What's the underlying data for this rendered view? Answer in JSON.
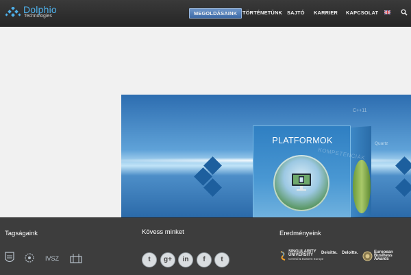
{
  "header": {
    "logo": {
      "name": "Dolphio",
      "subtitle": "Technologies"
    },
    "nav": [
      {
        "label": "MEGOLDÁSAINK",
        "active": true
      },
      {
        "label": "TÖRTÉNETÜNK",
        "active": false
      },
      {
        "label": "SAJTÓ",
        "active": false
      },
      {
        "label": "KARRIER",
        "active": false
      },
      {
        "label": "KAPCSOLAT",
        "active": false
      }
    ],
    "language_icon": "uk-flag-icon",
    "search_icon": "search-icon"
  },
  "banner": {
    "title": "PLATFORMOK",
    "side_labels": [
      "C++11",
      "Quartz",
      "KOMPETENCIÁK"
    ]
  },
  "footer": {
    "memberships": {
      "heading": "Tagságaink"
    },
    "follow": {
      "heading": "Kövess minket",
      "networks": [
        {
          "name": "tumblr",
          "glyph": "t"
        },
        {
          "name": "google-plus",
          "glyph": "g+"
        },
        {
          "name": "linkedin",
          "glyph": "in"
        },
        {
          "name": "facebook",
          "glyph": "f"
        },
        {
          "name": "twitter",
          "glyph": "t"
        }
      ]
    },
    "achievements": {
      "heading": "Eredményeink",
      "awards": [
        {
          "line1": "SINGULARITY",
          "line2": "UNIVERSITY",
          "line3": "Central & Eastern Europe"
        },
        {
          "line1": "Deloitte."
        },
        {
          "line1": "Deloitte."
        },
        {
          "line1": "European",
          "line2": "Business",
          "line3": "Awards"
        }
      ]
    }
  },
  "colors": {
    "accent": "#4fb0ea",
    "header_bg": "#2c2c2c",
    "footer_bg": "#3d3d3d",
    "nav_active": "#4f7fbe"
  }
}
